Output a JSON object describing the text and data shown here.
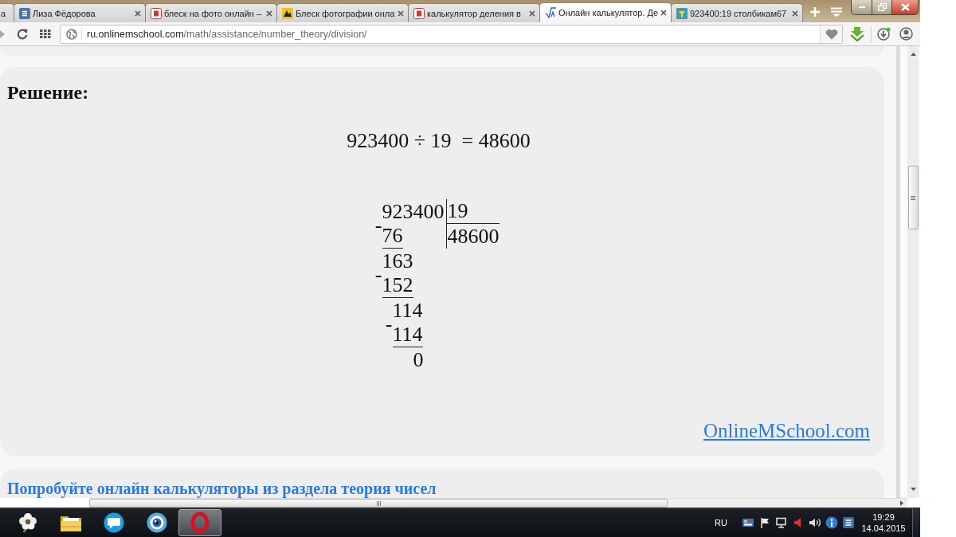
{
  "browser": {
    "clipped_tab": {
      "label": "а"
    },
    "tabs": [
      {
        "kind": "vk",
        "label": "Лиза Фёдорова",
        "selected": false
      },
      {
        "kind": "ya",
        "label": "блеск на фото онлайн –",
        "selected": false
      },
      {
        "kind": "li",
        "label": "Блеск фотографии онла",
        "selected": false
      },
      {
        "kind": "ya",
        "label": "калькулятор деления в",
        "selected": false
      },
      {
        "kind": "root",
        "label": "Онлайн калькулятор. Де",
        "selected": true
      },
      {
        "kind": "cup",
        "label": "923400:19 столбикам67",
        "selected": false
      }
    ],
    "address_bar": {
      "host": "ru.onlinemschool.com",
      "path": "/math/assistance/number_theory/division/"
    }
  },
  "page": {
    "heading": "Решение:",
    "equation": "923400 ÷ 19  = 48600",
    "long_division": {
      "dividend": "923400",
      "divisor": "19",
      "quotient": "48600",
      "steps": [
        {
          "kind": "subtrahend",
          "sign": "-",
          "text": "76"
        },
        {
          "kind": "partial",
          "text": "163"
        },
        {
          "kind": "subtrahend",
          "sign": "-",
          "text": "152"
        },
        {
          "kind": "partial",
          "text": "114"
        },
        {
          "kind": "subtrahend",
          "sign": "-",
          "text": "114"
        },
        {
          "kind": "remainder",
          "text": "0"
        }
      ]
    },
    "site_link": "OnlineMSchool.com",
    "next_section": {
      "heading": "Попробуйте онлайн калькуляторы из раздела теория чисел"
    }
  },
  "taskbar": {
    "apps": [
      {
        "kind": "flower",
        "selected": false
      },
      {
        "kind": "folder",
        "selected": false
      },
      {
        "kind": "chat",
        "selected": false
      },
      {
        "kind": "webcam",
        "selected": false
      },
      {
        "kind": "ring",
        "selected": true
      }
    ],
    "language": "RU",
    "time": "19:29",
    "date": "14.04.2015"
  }
}
